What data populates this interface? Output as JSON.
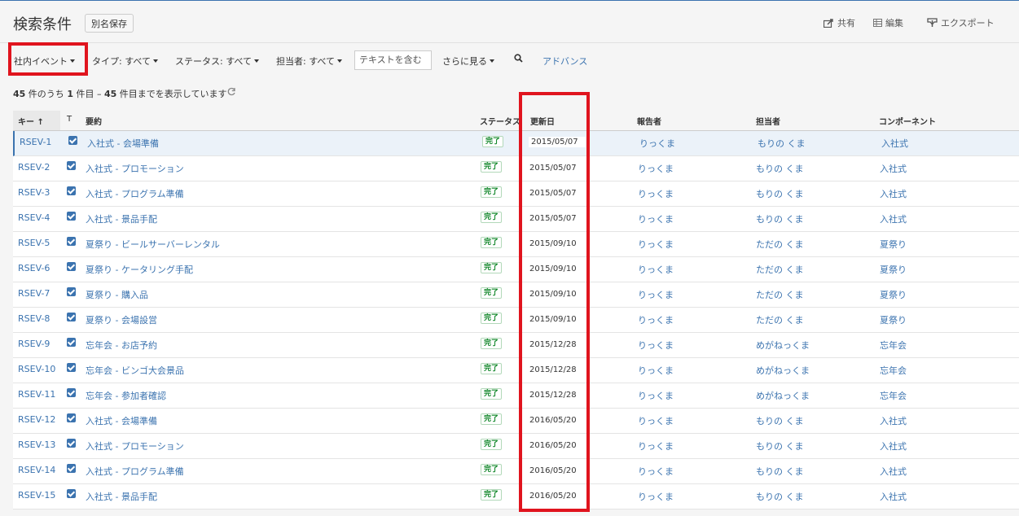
{
  "header": {
    "title": "検索条件",
    "save_as": "別名保存",
    "share": "共有",
    "edit": "編集",
    "export": "エクスポート"
  },
  "filters": {
    "project": "社内イベント",
    "type": "タイプ: すべて",
    "status": "ステータス: すべて",
    "assignee": "担当者: すべて",
    "text_placeholder": "テキストを含む",
    "more": "さらに見る",
    "advanced": "アドバンス"
  },
  "summary": {
    "total": "45",
    "pre": " 件のうち ",
    "from": "1",
    "mid": " 件目 – ",
    "to": "45",
    "post": " 件目までを表示しています"
  },
  "columns": {
    "key": "キー ↑",
    "type": "T",
    "summary": "要約",
    "status": "ステータス",
    "updated": "更新日",
    "reporter": "報告者",
    "assignee": "担当者",
    "component": "コンポーネント"
  },
  "rows": [
    {
      "key": "RSEV-1",
      "summary": "入社式 - 会場準備",
      "status": "完了",
      "updated": "2015/05/07",
      "reporter": "りっくま",
      "assignee": "もりの くま",
      "component": "入社式"
    },
    {
      "key": "RSEV-2",
      "summary": "入社式 - プロモーション",
      "status": "完了",
      "updated": "2015/05/07",
      "reporter": "りっくま",
      "assignee": "もりの くま",
      "component": "入社式"
    },
    {
      "key": "RSEV-3",
      "summary": "入社式 - プログラム準備",
      "status": "完了",
      "updated": "2015/05/07",
      "reporter": "りっくま",
      "assignee": "もりの くま",
      "component": "入社式"
    },
    {
      "key": "RSEV-4",
      "summary": "入社式 - 景品手配",
      "status": "完了",
      "updated": "2015/05/07",
      "reporter": "りっくま",
      "assignee": "もりの くま",
      "component": "入社式"
    },
    {
      "key": "RSEV-5",
      "summary": "夏祭り - ビールサーバーレンタル",
      "status": "完了",
      "updated": "2015/09/10",
      "reporter": "りっくま",
      "assignee": "ただの くま",
      "component": "夏祭り"
    },
    {
      "key": "RSEV-6",
      "summary": "夏祭り - ケータリング手配",
      "status": "完了",
      "updated": "2015/09/10",
      "reporter": "りっくま",
      "assignee": "ただの くま",
      "component": "夏祭り"
    },
    {
      "key": "RSEV-7",
      "summary": "夏祭り - 購入品",
      "status": "完了",
      "updated": "2015/09/10",
      "reporter": "りっくま",
      "assignee": "ただの くま",
      "component": "夏祭り"
    },
    {
      "key": "RSEV-8",
      "summary": "夏祭り - 会場設営",
      "status": "完了",
      "updated": "2015/09/10",
      "reporter": "りっくま",
      "assignee": "ただの くま",
      "component": "夏祭り"
    },
    {
      "key": "RSEV-9",
      "summary": "忘年会 - お店予約",
      "status": "完了",
      "updated": "2015/12/28",
      "reporter": "りっくま",
      "assignee": "めがねっくま",
      "component": "忘年会"
    },
    {
      "key": "RSEV-10",
      "summary": "忘年会 - ビンゴ大会景品",
      "status": "完了",
      "updated": "2015/12/28",
      "reporter": "りっくま",
      "assignee": "めがねっくま",
      "component": "忘年会"
    },
    {
      "key": "RSEV-11",
      "summary": "忘年会 - 参加者確認",
      "status": "完了",
      "updated": "2015/12/28",
      "reporter": "りっくま",
      "assignee": "めがねっくま",
      "component": "忘年会"
    },
    {
      "key": "RSEV-12",
      "summary": "入社式 - 会場準備",
      "status": "完了",
      "updated": "2016/05/20",
      "reporter": "りっくま",
      "assignee": "もりの くま",
      "component": "入社式"
    },
    {
      "key": "RSEV-13",
      "summary": "入社式 - プロモーション",
      "status": "完了",
      "updated": "2016/05/20",
      "reporter": "りっくま",
      "assignee": "もりの くま",
      "component": "入社式"
    },
    {
      "key": "RSEV-14",
      "summary": "入社式 - プログラム準備",
      "status": "完了",
      "updated": "2016/05/20",
      "reporter": "りっくま",
      "assignee": "もりの くま",
      "component": "入社式"
    },
    {
      "key": "RSEV-15",
      "summary": "入社式 - 景品手配",
      "status": "完了",
      "updated": "2016/05/20",
      "reporter": "りっくま",
      "assignee": "もりの くま",
      "component": "入社式"
    }
  ]
}
